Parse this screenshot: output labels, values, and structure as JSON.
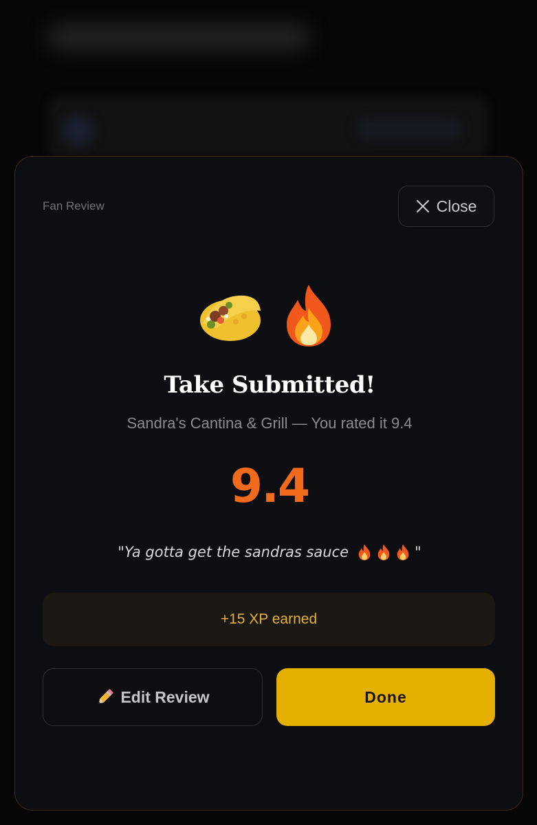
{
  "sheet": {
    "label": "Fan Review",
    "close_label": "Close",
    "icons": [
      "taco-icon",
      "fire-icon"
    ]
  },
  "confirmation": {
    "headline": "Take Submitted!",
    "subline": "Sandra's Cantina & Grill — You rated it 9.4",
    "score": "9.4",
    "quote_text": "\"Ya gotta get the sandras sauce",
    "quote_end": "\"",
    "xp_text": "+15 XP earned"
  },
  "actions": {
    "edit_label": "Edit Review",
    "done_label": "Done"
  },
  "colors": {
    "accent_orange": "#f26a1b",
    "button_yellow": "#e6b000",
    "xp_text": "#e3b13a",
    "sheet_bg": "#0d0e12"
  }
}
